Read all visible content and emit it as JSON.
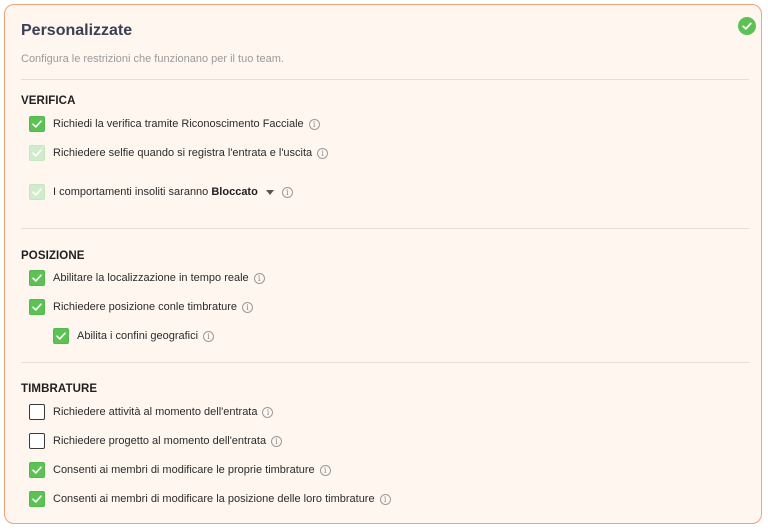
{
  "header": {
    "title": "Personalizzate",
    "subtitle": "Configura le restrizioni che funzionano per il tuo team.",
    "status_icon": "check-circle-icon"
  },
  "info_glyph": "i",
  "colors": {
    "accent_green": "#5cc254",
    "card_border": "#f0a373",
    "card_background": "#fff6f0"
  },
  "sections": {
    "verifica": {
      "title": "VERIFICA",
      "items": [
        {
          "label": "Richiedi la verifica tramite Riconoscimento Facciale",
          "state": "checked"
        },
        {
          "label": "Richiedere selfie quando si registra l'entrata e l'uscita",
          "state": "checked-disabled"
        },
        {
          "label_prefix": "I comportamenti insoliti saranno",
          "label_value": "Bloccato",
          "state": "checked-disabled"
        }
      ]
    },
    "posizione": {
      "title": "POSIZIONE",
      "items": [
        {
          "label": "Abilitare la localizzazione in tempo reale",
          "state": "checked"
        },
        {
          "label": "Richiedere posizione conle timbrature",
          "state": "checked"
        },
        {
          "label": "Abilita i confini geografici",
          "state": "checked"
        }
      ]
    },
    "timbrature": {
      "title": "TIMBRATURE",
      "items": [
        {
          "label": "Richiedere attività al momento dell'entrata",
          "state": "unchecked"
        },
        {
          "label": "Richiedere progetto al momento dell'entrata",
          "state": "unchecked"
        },
        {
          "label": "Consenti ai membri di modificare le proprie timbrature",
          "state": "checked"
        },
        {
          "label": "Consenti ai membri di modificare la posizione delle loro timbrature",
          "state": "checked"
        }
      ]
    }
  }
}
